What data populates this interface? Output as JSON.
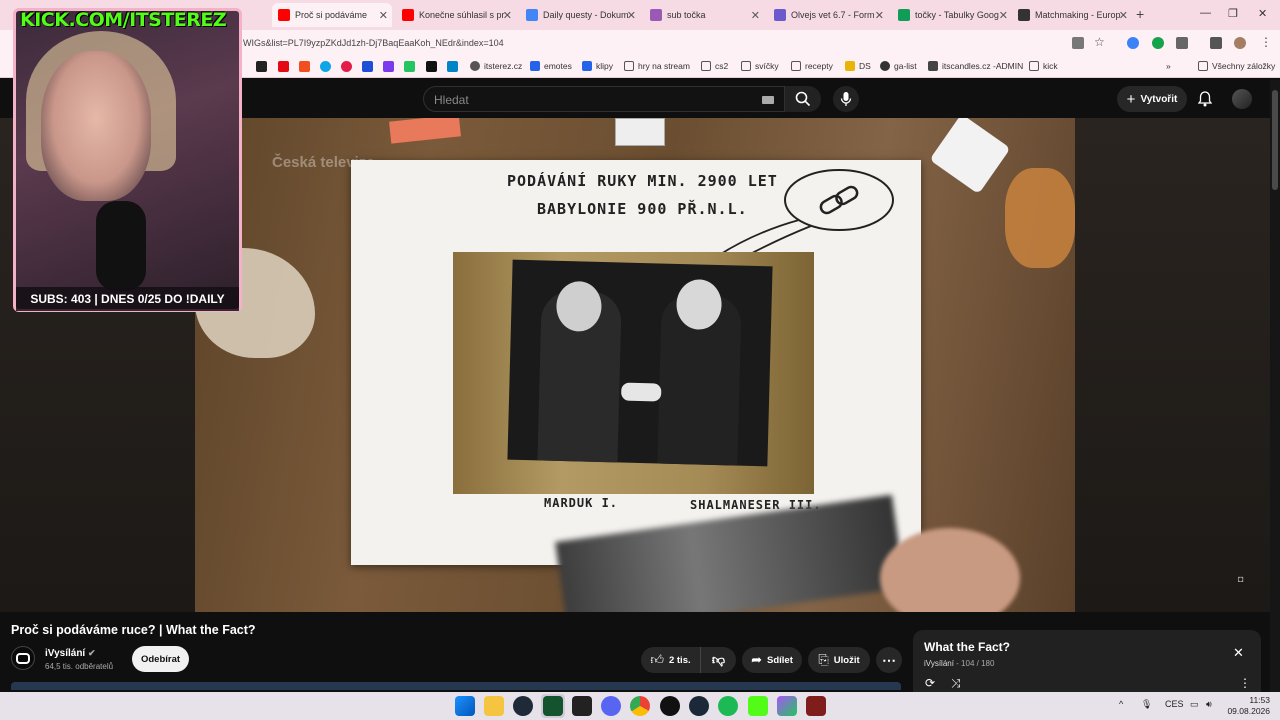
{
  "browser": {
    "tabs": [
      {
        "label": "Proč si podáváme",
        "color": "#ff0000",
        "active": true
      },
      {
        "label": "Konečne súhlasil s pr",
        "color": "#ff0000",
        "active": false
      },
      {
        "label": "Daily questy - Dokum",
        "color": "#4285f4",
        "active": false
      },
      {
        "label": "sub točka",
        "color": "#9b59b6",
        "active": false
      },
      {
        "label": "Olvejs vet 6.7 - Form",
        "color": "#6a5acd",
        "active": false
      },
      {
        "label": "točky - Tabulky Goog",
        "color": "#0f9d58",
        "active": false
      },
      {
        "label": "Matchmaking - Europ",
        "color": "#333333",
        "active": false
      }
    ],
    "url": "WIGs&list=PL7I9yzpZKdJd1zh-Dj7BaqEaaKoh_NEdr&index=104",
    "bookmarks": [
      {
        "label": "itsterez.cz"
      },
      {
        "label": "emotes"
      },
      {
        "label": "klipy"
      },
      {
        "label": "hry na stream"
      },
      {
        "label": "cs2"
      },
      {
        "label": "svíčky"
      },
      {
        "label": "recepty"
      },
      {
        "label": "DS"
      },
      {
        "label": "ga-list"
      },
      {
        "label": "itscandles.cz -ADMIN"
      },
      {
        "label": "kick"
      }
    ],
    "all_bookmarks": "Všechny záložky"
  },
  "youtube": {
    "search_placeholder": "Hledat",
    "create_label": "Vytvořit",
    "video": {
      "watermark": "Česká televize",
      "board_line1": "PODÁVÁNÍ RUKY MIN. 2900 LET",
      "board_line2": "BABYLONIE 900 PŘ.N.L.",
      "label_left": "MARDUK I.",
      "label_right": "SHALMANESER III."
    },
    "title": "Proč si podáváme ruce? | What the Fact?",
    "channel_name": "iVysílání",
    "subscriber_count": "64,5 tis. odběratelů",
    "subscribe_label": "Odebírat",
    "like_count": "2 tis.",
    "share_label": "Sdílet",
    "save_label": "Uložit",
    "playlist": {
      "title": "What the Fact?",
      "channel": "iVysílání",
      "position": "104 / 180"
    }
  },
  "overlay": {
    "kick_url": "KICK.COM/ITSTEREZ",
    "subs_text": "SUBS: 403 | DNES 0/25 DO !DAILY"
  },
  "taskbar": {
    "language": "CES",
    "time": "11:53",
    "date": "09.08.2026"
  },
  "colors": {
    "yt_bg": "#0f0f0f",
    "kick_green": "#53fc18",
    "overlay_pink": "#f3b2c8",
    "browser_pink": "#f6dbe4"
  }
}
